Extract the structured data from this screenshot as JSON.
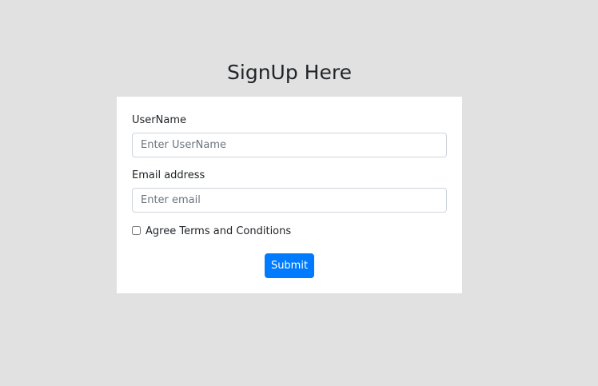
{
  "page": {
    "title": "SignUp Here"
  },
  "form": {
    "username": {
      "label": "UserName",
      "placeholder": "Enter UserName",
      "value": ""
    },
    "email": {
      "label": "Email address",
      "placeholder": "Enter email",
      "value": ""
    },
    "terms": {
      "label": "Agree Terms and Conditions",
      "checked": false
    },
    "submit_label": "Submit"
  },
  "colors": {
    "background": "#e1e1e1",
    "card": "#ffffff",
    "primary": "#007bff"
  }
}
